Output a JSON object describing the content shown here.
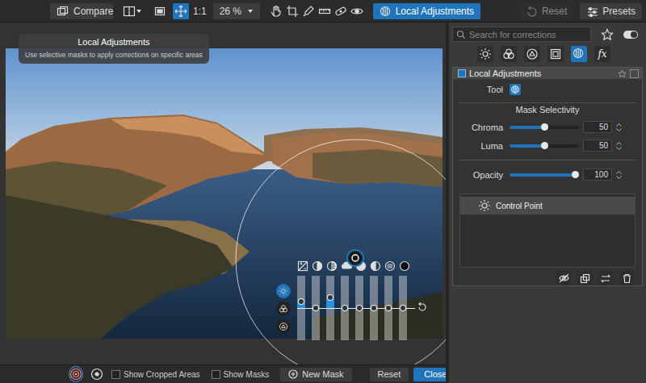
{
  "toolbar": {
    "compare": "Compare",
    "view_buttons": [
      {
        "kind": "split",
        "selected": false
      },
      {
        "kind": "crop-view",
        "selected": false
      },
      {
        "kind": "move",
        "selected": true
      }
    ],
    "zoom_ratio": "1:1",
    "zoom": "26 %",
    "tools": [
      {
        "kind": "hand",
        "selected": false
      },
      {
        "kind": "crop",
        "selected": false
      },
      {
        "kind": "picker",
        "selected": false
      },
      {
        "kind": "ruler",
        "selected": false
      },
      {
        "kind": "repair",
        "selected": false
      },
      {
        "kind": "eye",
        "selected": false
      }
    ],
    "mode": {
      "label": "Local Adjustments",
      "selected": true
    },
    "reset": {
      "label": "Reset",
      "disabled": true
    },
    "presets": "Presets"
  },
  "tooltip": {
    "title": "Local Adjustments",
    "text": "Use selective masks to apply corrections on specific areas"
  },
  "control_point": {
    "modes": [
      {
        "kind": "light",
        "selected": true
      },
      {
        "kind": "color",
        "selected": false
      },
      {
        "kind": "detail",
        "selected": false
      }
    ],
    "sliders": [
      {
        "level": 0.6
      },
      {
        "level": 0.5
      },
      {
        "level": 0.66
      },
      {
        "level": 0.5
      },
      {
        "level": 0.5
      },
      {
        "level": 0.5
      },
      {
        "level": 0.5
      },
      {
        "level": 0.5
      }
    ]
  },
  "bottom_bar": {
    "mask_tools": [
      {
        "kind": "control-point",
        "selected": true
      },
      {
        "kind": "control-line",
        "selected": false
      }
    ],
    "options": [
      {
        "label": "Show Cropped Areas",
        "checked": false
      },
      {
        "label": "Show Masks",
        "checked": false
      }
    ],
    "new_mask": "New Mask",
    "reset": "Reset",
    "close": "Close"
  },
  "panel": {
    "search": {
      "placeholder": "Search for corrections"
    },
    "toggle": {
      "on": true
    },
    "tabs": [
      {
        "kind": "light",
        "selected": false
      },
      {
        "kind": "color",
        "selected": false
      },
      {
        "kind": "detail",
        "selected": false
      },
      {
        "kind": "geometry",
        "selected": false
      },
      {
        "kind": "local",
        "selected": true
      },
      {
        "kind": "fx",
        "label": "fx",
        "selected": false
      }
    ],
    "section": {
      "title": "Local Adjustments",
      "enabled": true
    },
    "tool_label": "Tool",
    "mask_selectivity": "Mask Selectivity",
    "sliders": [
      {
        "label": "Chroma",
        "level": 0.5,
        "value": "50"
      },
      {
        "label": "Luma",
        "level": 0.5,
        "value": "50"
      },
      {
        "label": "Opacity",
        "level": 1,
        "value": "100"
      }
    ],
    "masks": [
      {
        "label": "Control Point",
        "selected": true
      }
    ]
  }
}
